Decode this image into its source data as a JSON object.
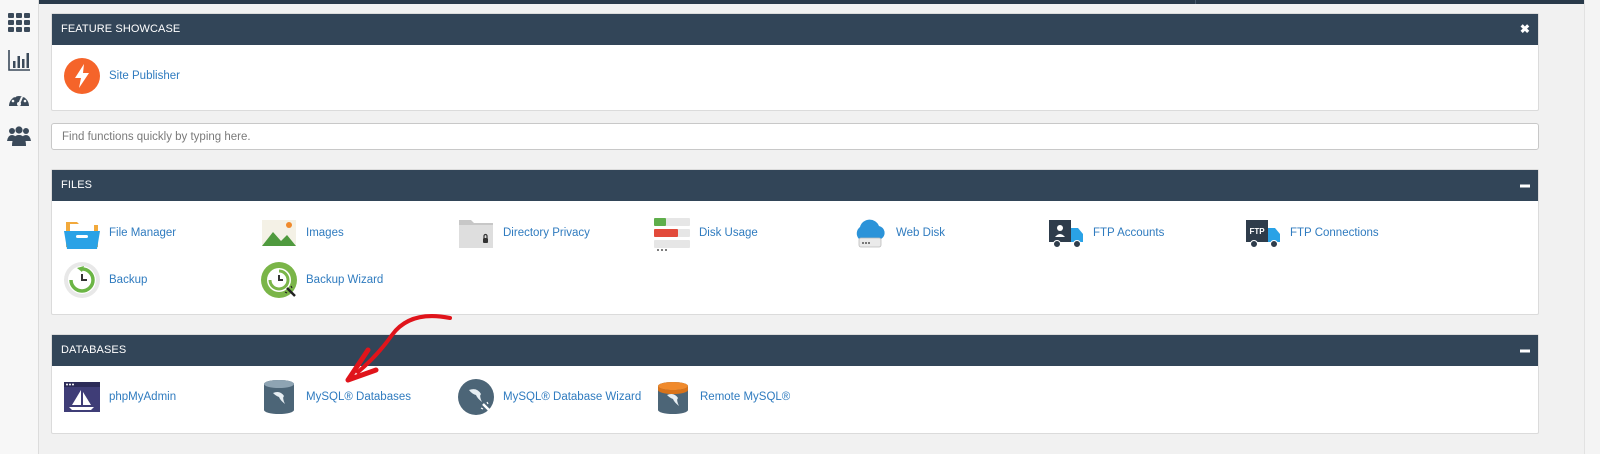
{
  "feature_showcase": {
    "title": "FEATURE SHOWCASE",
    "close_glyph": "✖",
    "items": [
      {
        "label": "Site Publisher",
        "icon": "lightning-icon"
      }
    ]
  },
  "search": {
    "placeholder": "Find functions quickly by typing here."
  },
  "files": {
    "title": "FILES",
    "collapse_glyph": "▬",
    "items": [
      {
        "label": "File Manager",
        "icon": "file-manager-icon"
      },
      {
        "label": "Images",
        "icon": "images-icon"
      },
      {
        "label": "Directory Privacy",
        "icon": "directory-privacy-icon"
      },
      {
        "label": "Disk Usage",
        "icon": "disk-usage-icon"
      },
      {
        "label": "Web Disk",
        "icon": "web-disk-icon"
      },
      {
        "label": "FTP Accounts",
        "icon": "ftp-accounts-icon"
      },
      {
        "label": "FTP Connections",
        "icon": "ftp-connections-icon"
      },
      {
        "label": "Backup",
        "icon": "backup-icon"
      },
      {
        "label": "Backup Wizard",
        "icon": "backup-wizard-icon"
      }
    ]
  },
  "databases": {
    "title": "DATABASES",
    "collapse_glyph": "▬",
    "items": [
      {
        "label": "phpMyAdmin",
        "icon": "phpmyadmin-icon"
      },
      {
        "label": "MySQL® Databases",
        "icon": "mysql-databases-icon"
      },
      {
        "label": "MySQL® Database Wizard",
        "icon": "mysql-wizard-icon"
      },
      {
        "label": "Remote MySQL®",
        "icon": "remote-mysql-icon"
      }
    ]
  },
  "sidebar": {
    "icons": [
      "grid-icon",
      "bar-chart-icon",
      "dashboard-gauge-icon",
      "users-icon"
    ]
  },
  "colors": {
    "header": "#324558",
    "link": "#2f7bbf",
    "annotation_arrow": "#e0141b"
  }
}
